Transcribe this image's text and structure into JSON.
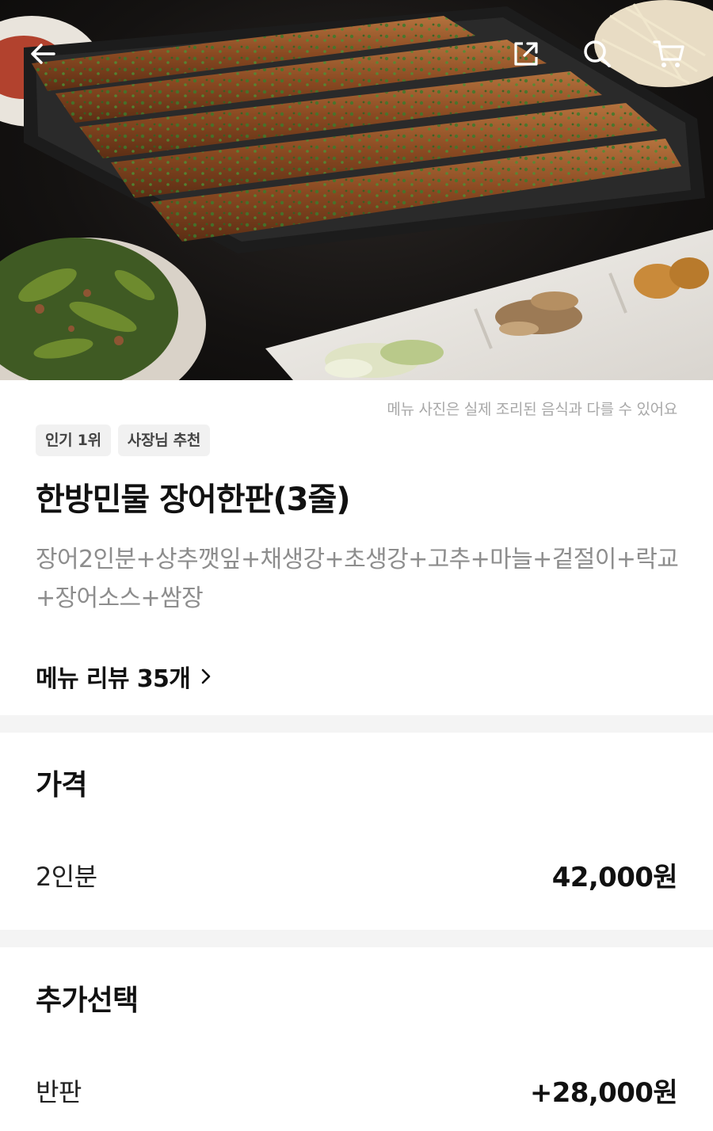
{
  "hero": {
    "icons": {
      "back": "arrow-left-icon",
      "share": "share-external-icon",
      "search": "search-icon",
      "cart": "cart-icon"
    }
  },
  "photo_note": "메뉴 사진은 실제 조리된 음식과 다를 수 있어요",
  "badges": [
    "인기 1위",
    "사장님 추천"
  ],
  "menu": {
    "title": "한방민물 장어한판(3줄)",
    "description": "장어2인분+상추깻잎+채생강+초생강+고추+마늘+겉절이+락교+장어소스+쌈장",
    "review_link": "메뉴 리뷰 35개"
  },
  "price": {
    "title": "가격",
    "rows": [
      {
        "label": "2인분",
        "value": "42,000원"
      }
    ]
  },
  "options": {
    "title": "추가선택",
    "rows": [
      {
        "label": "반판",
        "value": "+28,000원"
      }
    ]
  },
  "colors": {
    "badge_bg": "#f1f1f1",
    "divider": "#f4f4f4",
    "muted_text": "#8d8d8d",
    "note_text": "#a8a8a8"
  }
}
